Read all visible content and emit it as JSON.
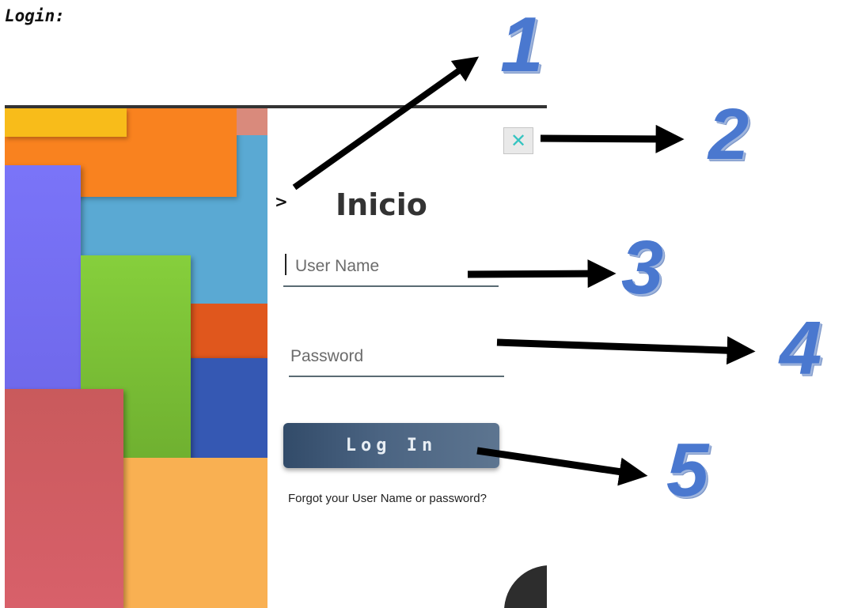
{
  "document": {
    "heading": "Login:"
  },
  "login_panel": {
    "caret": ">",
    "title": "Inicio",
    "close_symbol": "✕",
    "username_placeholder": "User Name",
    "password_placeholder": "Password",
    "login_label": "Log In",
    "forgot_text": "Forgot your User Name or password?"
  },
  "annotations": {
    "labels": [
      "1",
      "2",
      "3",
      "4",
      "5"
    ]
  },
  "colors": {
    "annotation_blue": "#4a78cf",
    "button_gradient_start": "#324b69",
    "button_gradient_end": "#5d7590",
    "close_x": "#35c4c1"
  },
  "decoration": {
    "mosaic_tiles": [
      {
        "name": "yellow-tile",
        "color": "#f8bc1a"
      },
      {
        "name": "orange-tile",
        "color": "#f9821f"
      },
      {
        "name": "salmon-tile",
        "color": "#d98a7c"
      },
      {
        "name": "violet-tile",
        "color": "#7672f5"
      },
      {
        "name": "green-tile",
        "color": "#7fc83a"
      },
      {
        "name": "burnt-orange-tile",
        "color": "#e0571d"
      },
      {
        "name": "navy-tile",
        "color": "#3558b3"
      },
      {
        "name": "red-tile",
        "color": "#d25a5e"
      },
      {
        "name": "amber-tile",
        "color": "#f9b052"
      }
    ]
  }
}
